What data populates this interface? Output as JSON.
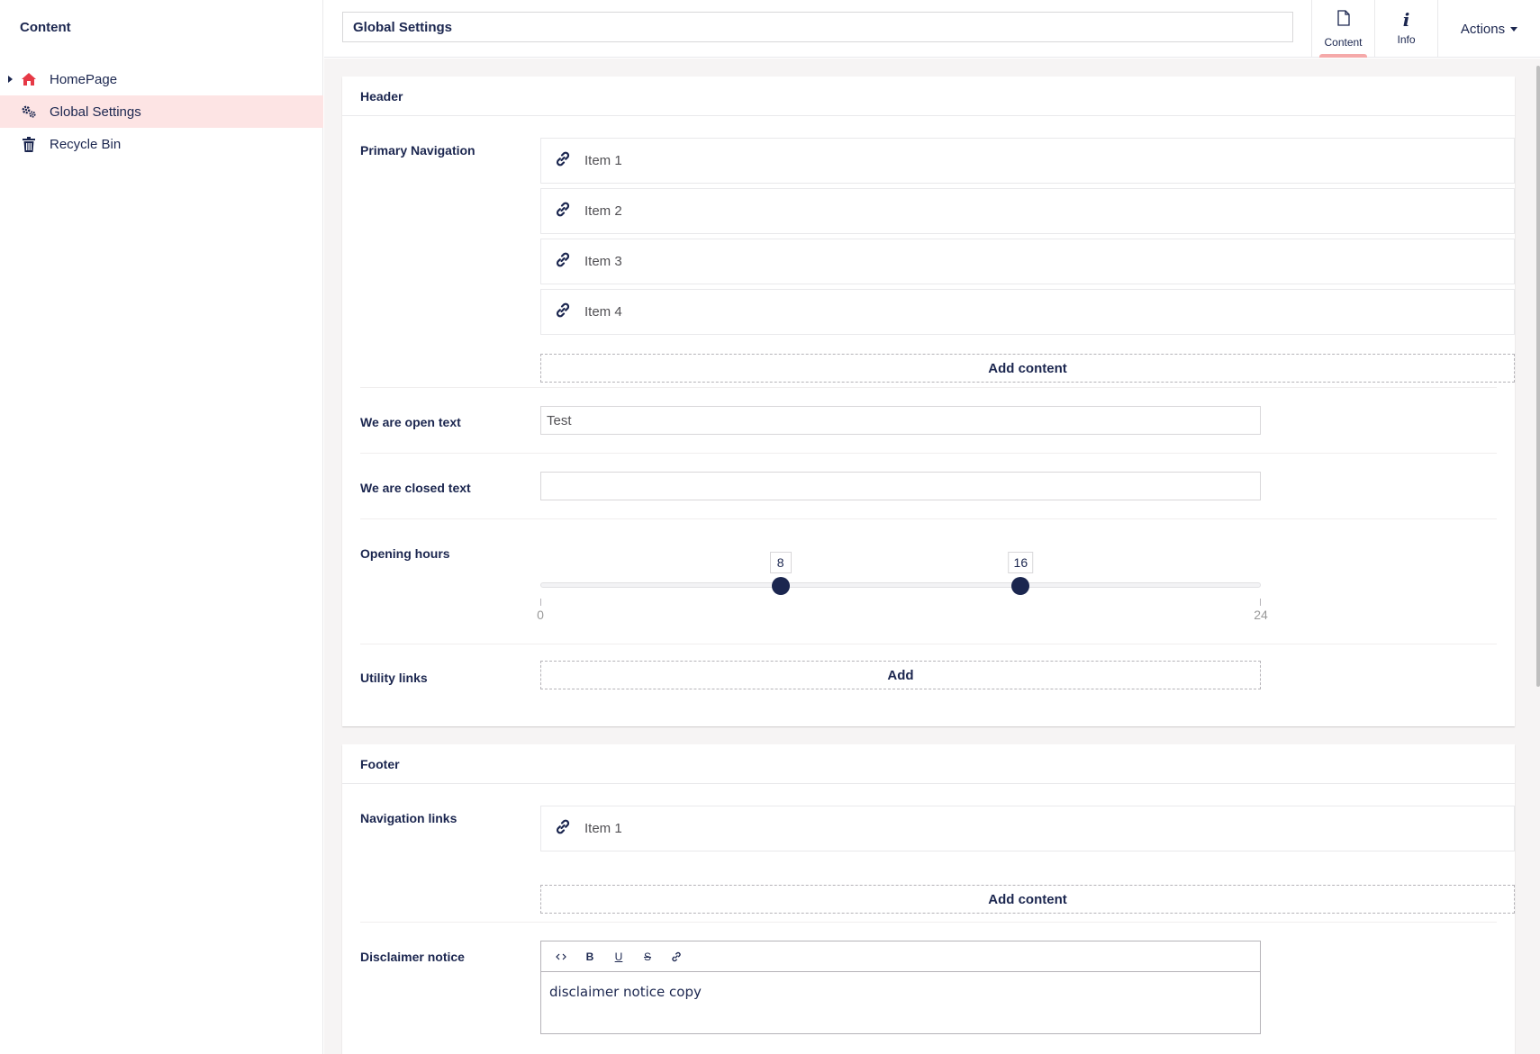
{
  "sidebar": {
    "title": "Content",
    "items": [
      {
        "label": "HomePage"
      },
      {
        "label": "Global Settings"
      },
      {
        "label": "Recycle Bin"
      }
    ]
  },
  "header": {
    "name_value": "Global Settings",
    "tabs": [
      {
        "label": "Content"
      },
      {
        "label": "Info"
      }
    ],
    "actions_label": "Actions"
  },
  "header_group": {
    "title": "Header",
    "primary_navigation": {
      "label": "Primary Navigation",
      "items": [
        {
          "label": "Item 1"
        },
        {
          "label": "Item 2"
        },
        {
          "label": "Item 3"
        },
        {
          "label": "Item 4"
        }
      ],
      "add_label": "Add content"
    },
    "open_text": {
      "label": "We are open text",
      "value": "Test"
    },
    "closed_text": {
      "label": "We are closed text",
      "value": ""
    },
    "opening_hours": {
      "label": "Opening hours",
      "min": 0,
      "max": 24,
      "from": 8,
      "to": 16,
      "min_label": "0",
      "max_label": "24",
      "from_label": "8",
      "to_label": "16"
    },
    "utility_links": {
      "label": "Utility links",
      "add_label": "Add"
    }
  },
  "footer_group": {
    "title": "Footer",
    "navigation_links": {
      "label": "Navigation links",
      "items": [
        {
          "label": "Item 1"
        }
      ],
      "add_label": "Add content"
    },
    "disclaimer": {
      "label": "Disclaimer notice",
      "toolbar": [
        "code",
        "bold",
        "underline",
        "strikethrough",
        "link"
      ],
      "body": "disclaimer notice copy"
    }
  },
  "colors": {
    "primary": "#1b264f",
    "active_background": "#fde4e4",
    "home_icon": "#e63946",
    "tab_indicator": "#f5a9a9"
  }
}
